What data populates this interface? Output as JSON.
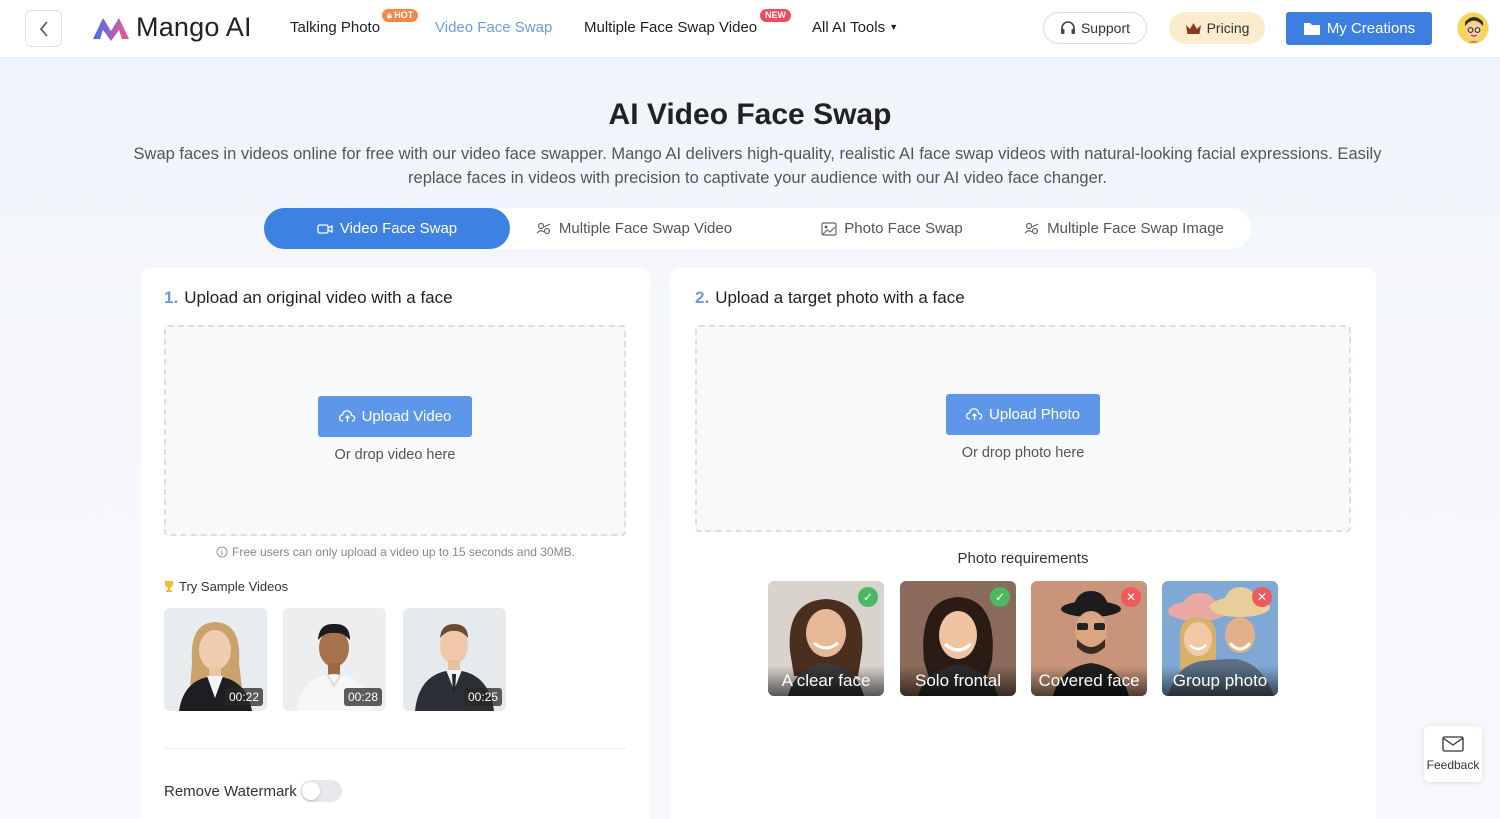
{
  "header": {
    "logo_text": "Mango AI",
    "nav": [
      {
        "label": "Talking Photo",
        "badge": "HOT"
      },
      {
        "label": "Video Face Swap"
      },
      {
        "label": "Multiple Face Swap Video",
        "badge": "NEW"
      },
      {
        "label": "All AI Tools"
      }
    ],
    "support_label": "Support",
    "pricing_label": "Pricing",
    "creations_label": "My Creations"
  },
  "hero": {
    "title": "AI Video Face Swap",
    "subtitle": "Swap faces in videos online for free with our video face swapper. Mango AI delivers high-quality, realistic AI face swap videos with natural-looking facial expressions. Easily replace faces in videos with precision to captivate your audience with our AI video face changer."
  },
  "tabs": [
    {
      "label": "Video Face Swap",
      "icon": "video-camera-icon"
    },
    {
      "label": "Multiple Face Swap Video",
      "icon": "multi-face-icon"
    },
    {
      "label": "Photo Face Swap",
      "icon": "image-icon"
    },
    {
      "label": "Multiple Face Swap Image",
      "icon": "multi-face-icon"
    }
  ],
  "left_panel": {
    "step_num": "1.",
    "step_title": "Upload an original video with a face",
    "upload_label": "Upload Video",
    "drop_hint": "Or drop video here",
    "note": "Free users can only upload a video up to 15 seconds and 30MB.",
    "samples_label": "Try Sample Videos",
    "samples": [
      {
        "duration": "00:22"
      },
      {
        "duration": "00:28"
      },
      {
        "duration": "00:25"
      }
    ],
    "watermark_label": "Remove Watermark",
    "watermark_on": false
  },
  "right_panel": {
    "step_num": "2.",
    "step_title": "Upload a target photo with a face",
    "upload_label": "Upload Photo",
    "drop_hint": "Or drop photo here",
    "requirements_title": "Photo requirements",
    "requirements": [
      {
        "label": "A clear face",
        "ok": true
      },
      {
        "label": "Solo frontal",
        "ok": true
      },
      {
        "label": "Covered face",
        "ok": false
      },
      {
        "label": "Group photo",
        "ok": false
      }
    ]
  },
  "feedback_label": "Feedback",
  "colors": {
    "accent": "#3d82e2",
    "nav_active": "#6f99e6",
    "hot_badge": "#f0894a",
    "new_badge": "#ef4b5c",
    "pricing_bg": "#fbeccd"
  }
}
